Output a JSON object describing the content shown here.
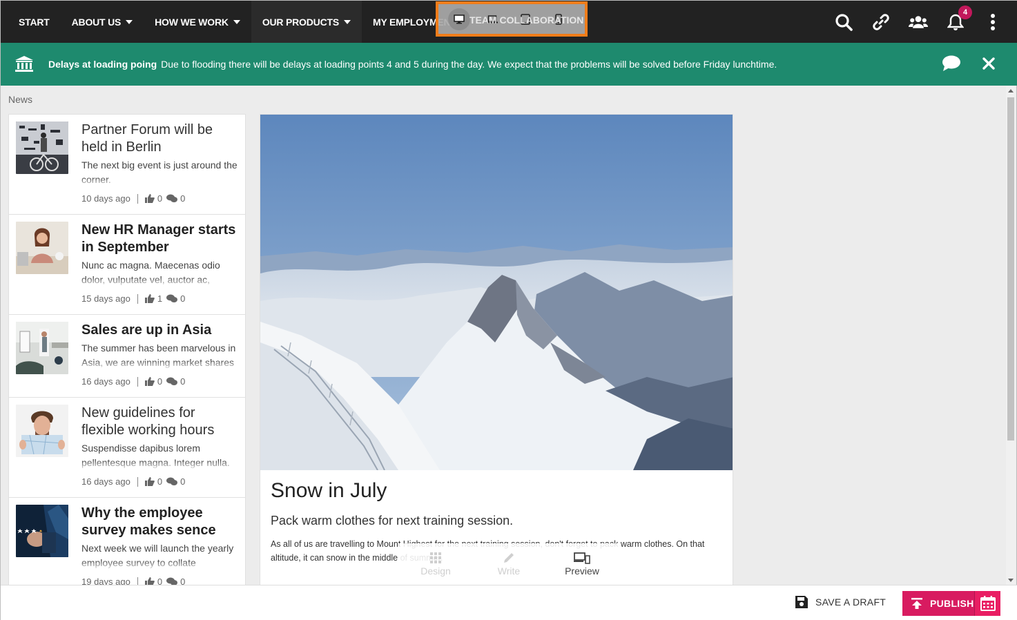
{
  "nav": {
    "items": [
      {
        "label": "START"
      },
      {
        "label": "ABOUT US"
      },
      {
        "label": "HOW WE WORK"
      },
      {
        "label": "OUR PRODUCTS"
      },
      {
        "label": "MY EMPLOYMENT"
      }
    ],
    "hidden_item": "TEAM COLLABORATION",
    "notification_count": "4",
    "icons": [
      "search-icon",
      "link-icon",
      "users-icon",
      "bell-icon",
      "more-vertical-icon"
    ]
  },
  "device_switcher": {
    "options": [
      "desktop-icon",
      "laptop-icon",
      "tablet-icon",
      "mobile-icon"
    ],
    "selected": "desktop-icon"
  },
  "alert": {
    "title": "Delays at loading poing",
    "message": "Due to flooding there will be delays at loading points 4 and 5 during the day. We expect that the problems will be solved before Friday lunchtime.",
    "colors": {
      "background": "#1e8a6e"
    }
  },
  "section": {
    "label": "News"
  },
  "news": [
    {
      "title": "Partner Forum will be held in Berlin",
      "teaser": "The next big event is just around the corner.",
      "time": "10 days ago",
      "likes": "0",
      "comments": "0"
    },
    {
      "title": "New HR Manager starts in September",
      "teaser": "Nunc ac magna. Maecenas odio dolor, vulputate vel, auctor ac,",
      "time": "15 days ago",
      "likes": "1",
      "comments": "0"
    },
    {
      "title": "Sales are up in Asia",
      "teaser": "The summer has been marvelous in Asia, we are winning market shares",
      "time": "16 days ago",
      "likes": "0",
      "comments": "0"
    },
    {
      "title": "New guidelines for flexible working hours",
      "teaser": "Suspendisse dapibus lorem pellentesque magna. Integer nulla.",
      "time": "16 days ago",
      "likes": "0",
      "comments": "0"
    },
    {
      "title": "Why the employee survey makes sence",
      "teaser": "Next week we will launch the yearly employee survey to collate",
      "time": "19 days ago",
      "likes": "0",
      "comments": "0"
    }
  ],
  "article": {
    "title": "Snow in July",
    "subtitle": "Pack warm clothes for next training session.",
    "body": "As all of us are travelling to Mount Highest for the next training session, don't forget to pack warm clothes. On that altitude, it can snow in the middle of summer."
  },
  "modes": [
    {
      "label": "Design",
      "icon": "grid-icon"
    },
    {
      "label": "Write",
      "icon": "pencil-icon"
    },
    {
      "label": "Preview",
      "icon": "devices-icon"
    }
  ],
  "footer": {
    "draft_label": "SAVE A DRAFT",
    "publish_label": "PUBLISH",
    "colors": {
      "publish": "#d81b60"
    }
  }
}
